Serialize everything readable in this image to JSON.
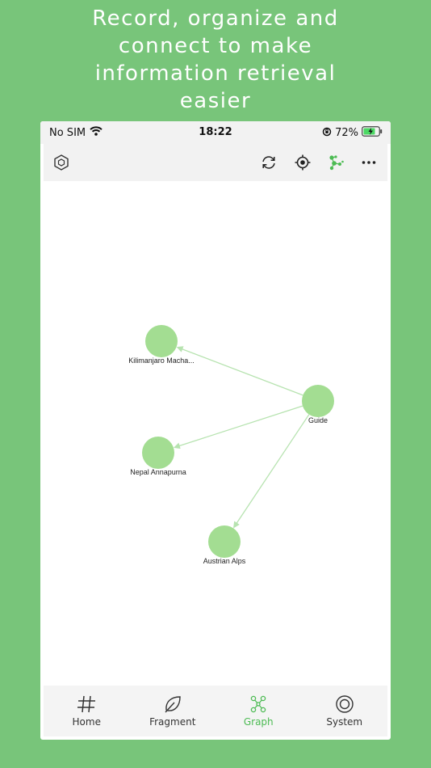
{
  "promo": {
    "lines": [
      "Record, organize and",
      "connect to make",
      "information retrieval",
      "easier"
    ]
  },
  "status_bar": {
    "carrier": "No SIM",
    "time": "18:22",
    "battery": "72%"
  },
  "toolbar": {
    "icons": [
      "hexagon-graph-icon",
      "sync-icon",
      "locate-icon",
      "graph-layout-icon",
      "more-icon"
    ]
  },
  "graph": {
    "nodes": [
      {
        "id": "kilimanjaro",
        "label": "Kilimanjaro Macha..."
      },
      {
        "id": "guide",
        "label": "Guide"
      },
      {
        "id": "nepal",
        "label": "Nepal Annapurna"
      },
      {
        "id": "alps",
        "label": "Austrian Alps"
      }
    ],
    "edges": [
      {
        "from": "guide",
        "to": "kilimanjaro"
      },
      {
        "from": "guide",
        "to": "nepal"
      },
      {
        "from": "guide",
        "to": "alps"
      }
    ],
    "node_color": "#a3dd92",
    "edge_color": "#b7e3b0"
  },
  "tabs": [
    {
      "id": "home",
      "label": "Home",
      "icon": "hash-icon",
      "active": false
    },
    {
      "id": "fragment",
      "label": "Fragment",
      "icon": "leaf-icon",
      "active": false
    },
    {
      "id": "graph",
      "label": "Graph",
      "icon": "graph-icon",
      "active": true
    },
    {
      "id": "system",
      "label": "System",
      "icon": "target-icon",
      "active": false
    }
  ],
  "colors": {
    "background": "#78c57a",
    "accent": "#4cbb53"
  }
}
